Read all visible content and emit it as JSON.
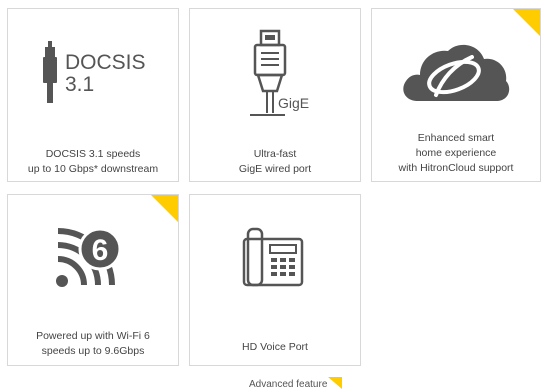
{
  "features": [
    {
      "id": "docsis",
      "icon": "docsis-connector-icon",
      "icon_text_line1": "DOCSIS",
      "icon_text_line2": "3.1",
      "caption_lines": [
        "DOCSIS 3.1 speeds",
        "up to 10 Gbps* downstream"
      ],
      "advanced": false
    },
    {
      "id": "gige",
      "icon": "ethernet-plug-icon",
      "icon_text": "GigE",
      "caption_lines": [
        "Ultra-fast",
        "GigE wired port"
      ],
      "advanced": false
    },
    {
      "id": "smart-home",
      "icon": "hitron-cloud-icon",
      "caption_lines": [
        "Enhanced smart",
        "home experience",
        "with HitronCloud support"
      ],
      "advanced": true
    },
    {
      "id": "wifi6",
      "icon": "wifi-6-icon",
      "icon_text": "6",
      "caption_lines": [
        "Powered up with Wi-Fi 6",
        "speeds up to 9.6Gbps"
      ],
      "advanced": true
    },
    {
      "id": "voice",
      "icon": "desk-phone-icon",
      "caption_lines": [
        "HD Voice Port"
      ],
      "advanced": false
    }
  ],
  "legend": {
    "label": "Advanced feature"
  },
  "colors": {
    "advanced_marker": "#ffcc00",
    "border": "#d8d8d8",
    "icon": "#555555",
    "text": "#444444"
  }
}
